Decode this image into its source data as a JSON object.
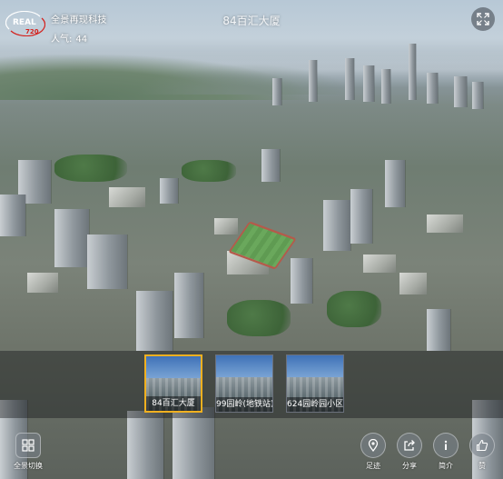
{
  "header": {
    "brand_name": "全景再现科技",
    "popularity_label": "人气:",
    "popularity_count": "44",
    "scene_title": "84百汇大厦"
  },
  "logo": {
    "text_top": "REAL",
    "text_bottom": "720"
  },
  "scenes": [
    {
      "label": "84百汇大厦",
      "active": true
    },
    {
      "label": "99园岭(地铁站)",
      "active": false
    },
    {
      "label": "624园岭园小区",
      "active": false
    }
  ],
  "bottom_left": {
    "label": "全景切换"
  },
  "toolbar": [
    {
      "label": "足迹",
      "icon": "location-pin-icon"
    },
    {
      "label": "分享",
      "icon": "share-icon"
    },
    {
      "label": "简介",
      "icon": "info-icon"
    },
    {
      "label": "赞",
      "icon": "thumbs-up-icon"
    }
  ],
  "colors": {
    "active_thumb_border": "#f0b020",
    "logo_red": "#d4201c"
  }
}
